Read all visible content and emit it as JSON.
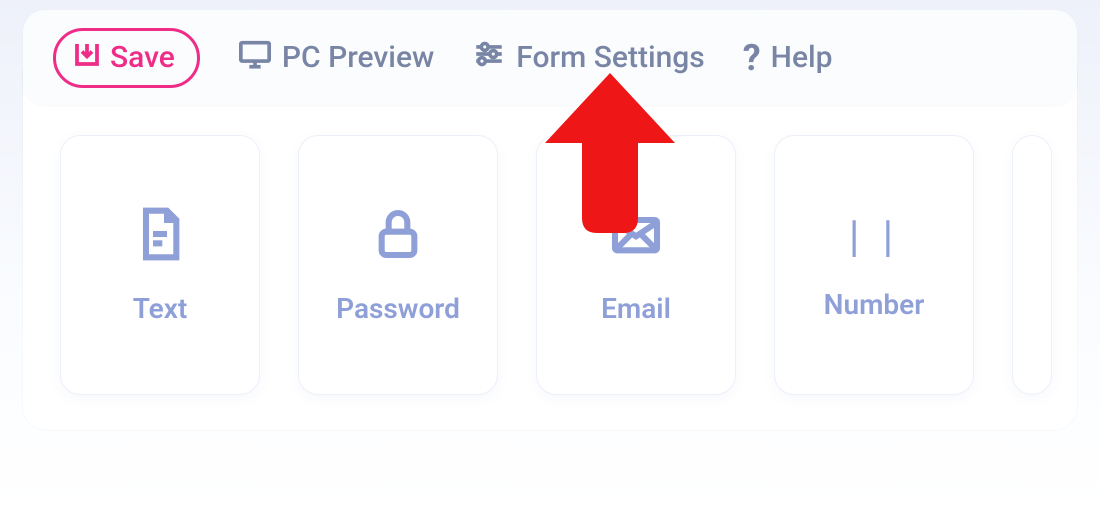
{
  "toolbar": {
    "save_label": "Save",
    "pc_preview_label": "PC Preview",
    "form_settings_label": "Form Settings",
    "help_label": "Help"
  },
  "cards": [
    {
      "label": "Text",
      "icon": "file-text"
    },
    {
      "label": "Password",
      "icon": "lock"
    },
    {
      "label": "Email",
      "icon": "envelope"
    },
    {
      "label": "Number",
      "icon": "bars"
    }
  ],
  "annotation": {
    "arrow_target": "form-settings-button"
  }
}
